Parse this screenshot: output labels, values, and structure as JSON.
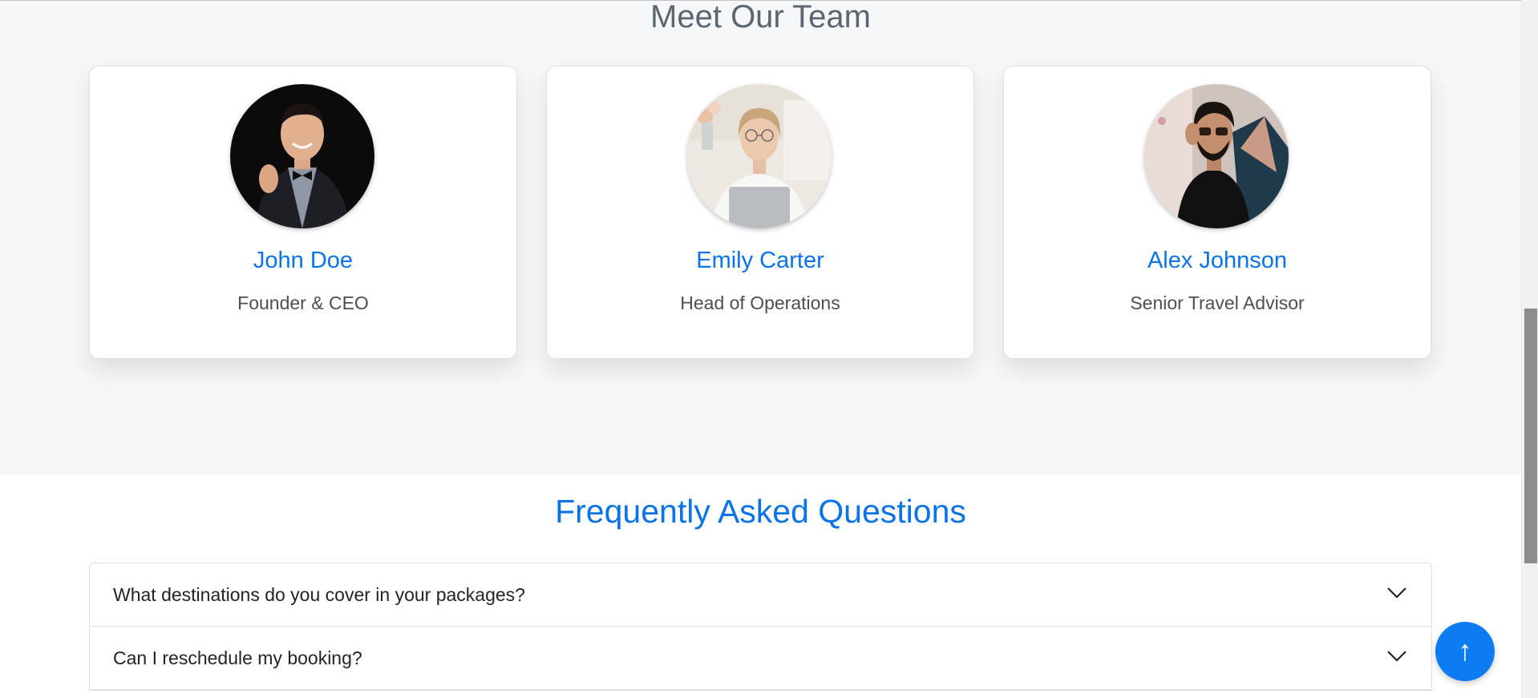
{
  "team": {
    "title": "Meet Our Team",
    "members": [
      {
        "name": "John Doe",
        "role": "Founder & CEO"
      },
      {
        "name": "Emily Carter",
        "role": "Head of Operations"
      },
      {
        "name": "Alex Johnson",
        "role": "Senior Travel Advisor"
      }
    ]
  },
  "faq": {
    "title": "Frequently Asked Questions",
    "items": [
      {
        "question": "What destinations do you cover in your packages?"
      },
      {
        "question": "Can I reschedule my booking?"
      }
    ]
  },
  "scroll_top": {
    "icon": "↑"
  },
  "colors": {
    "accent": "#0a73e8",
    "section_bg": "#f6f7f9",
    "text": "#212529",
    "muted": "#4a4f55"
  },
  "icons": {
    "faq_toggle": "chevron-down-icon",
    "scroll_top": "arrow-up-icon"
  }
}
